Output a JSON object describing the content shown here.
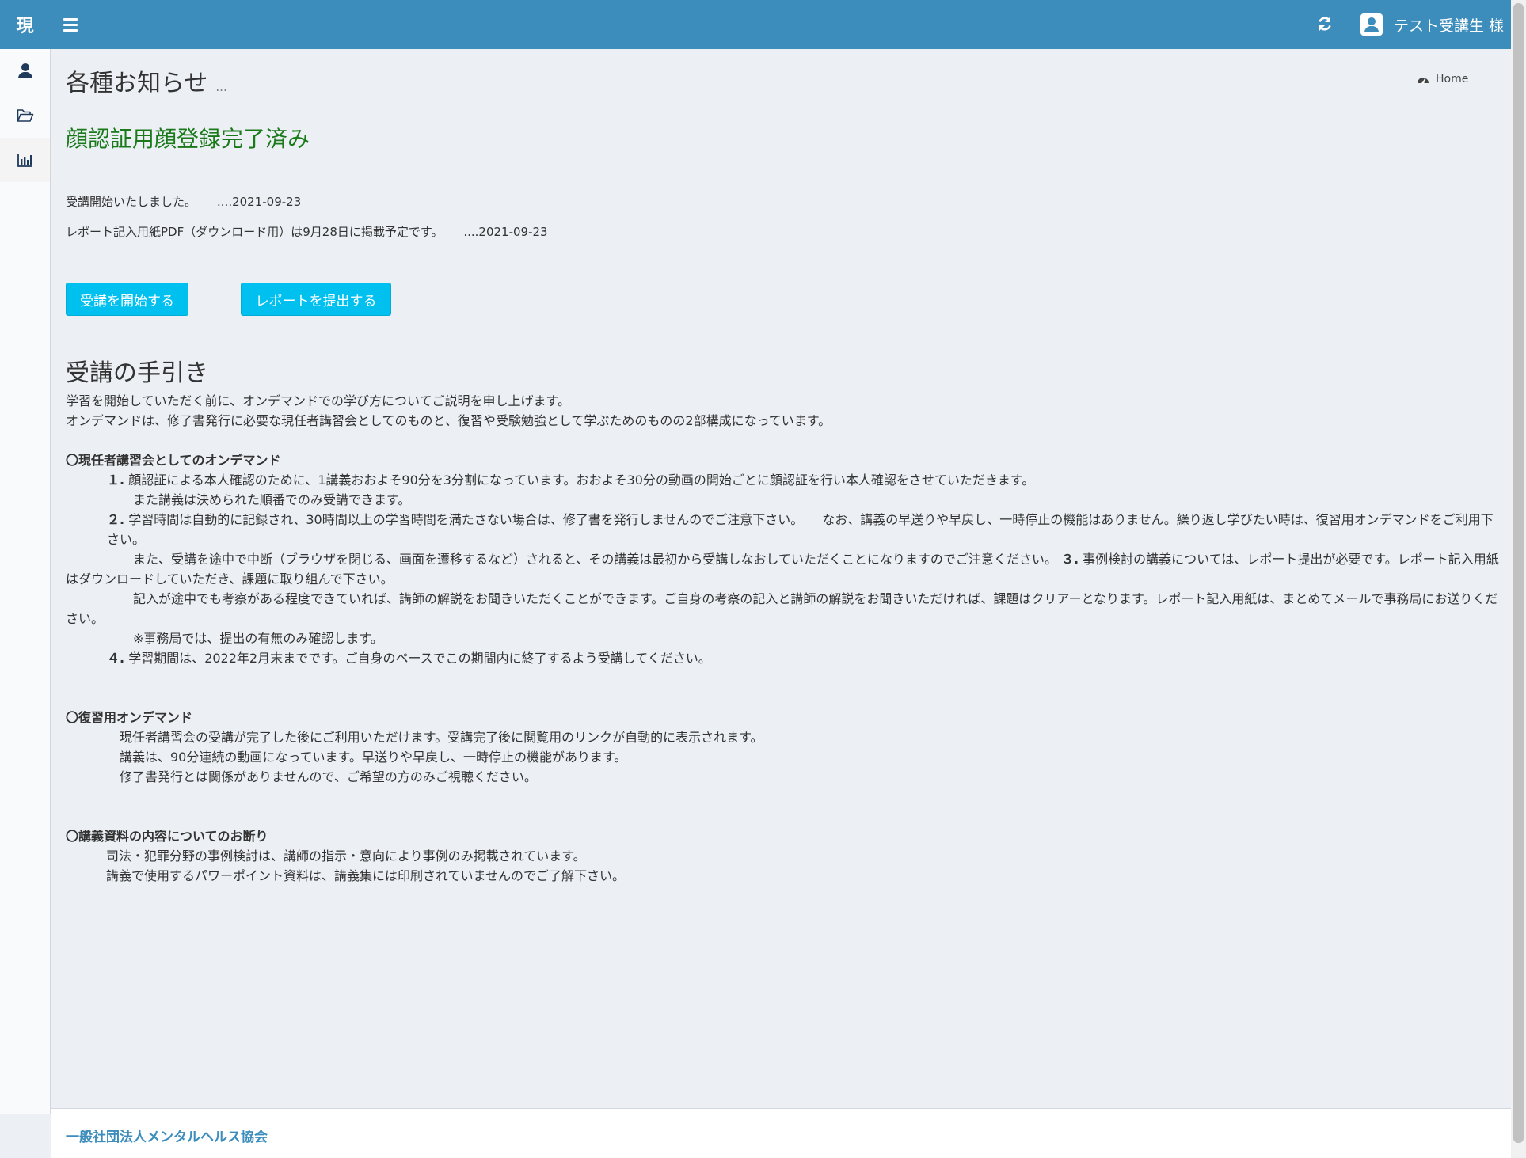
{
  "header": {
    "logo": "現",
    "user_name": "テスト受講生 様"
  },
  "sidebar": {
    "items": [
      {
        "icon": "person-icon"
      },
      {
        "icon": "folder-open-icon"
      },
      {
        "icon": "bar-chart-icon"
      }
    ]
  },
  "page": {
    "title": "各種お知らせ",
    "title_suffix": "...",
    "breadcrumb_home": "Home",
    "face_status": "顔認証用顔登録完了済み"
  },
  "notices": [
    {
      "text": "受講開始いたしました。",
      "date": "....2021-09-23"
    },
    {
      "text": "レポート記入用紙PDF（ダウンロード用）は9月28日に掲載予定です。",
      "date": "....2021-09-23"
    }
  ],
  "buttons": {
    "start": "受講を開始する",
    "report": "レポートを提出する"
  },
  "guide": {
    "title": "受講の手引き",
    "intro1": "学習を開始していただく前に、オンデマンドでの学び方についてご説明を申し上げます。",
    "intro2": "オンデマンドは、修了書発行に必要な現任者講習会としてのものと、復習や受験勉強として学ぶためのものの2部構成になっています。",
    "sec1": "〇現任者講習会としてのオンデマンド",
    "s1_num1": "１.",
    "s1_l1": "顔認証による本人確認のために、1講義おおよそ90分を3分割になっています。おおよそ30分の動画の開始ごとに顔認証を行い本人確認をさせていただきます。",
    "s1_l1b": "また講義は決められた順番でのみ受講できます。",
    "s1_num2": "２.",
    "s1_l2": "学習時間は自動的に記録され、30時間以上の学習時間を満たさない場合は、修了書を発行しませんのでご注意下さい。　　なお、講義の早送りや早戻し、一時停止の機能はありません。繰り返し学びたい時は、復習用オンデマンドをご利用下さい。",
    "s1_l2b": "また、受講を途中で中断（ブラウザを閉じる、画面を遷移するなど）されると、その講義は最初から受講しなおしていただくことになりますのでご注意ください。",
    "s1_num3": "３.",
    "s1_l3": "事例検討の講義については、レポート提出が必要です。レポート記入用紙はダウンロードしていただき、課題に取り組んで下さい。",
    "s1_l3b": "記入が途中でも考察がある程度できていれば、講師の解説をお聞きいただくことができます。ご自身の考察の記入と講師の解説をお聞きいただければ、課題はクリアーとなります。レポート記入用紙は、まとめてメールで事務局にお送りください。",
    "s1_l3c": "※事務局では、提出の有無のみ確認します。",
    "s1_num4": "４.",
    "s1_l4": "学習期間は、2022年2月末までです。ご自身のペースでこの期間内に終了するよう受講してください。",
    "sec2": "〇復習用オンデマンド",
    "s2_l1": "現任者講習会の受講が完了した後にご利用いただけます。受講完了後に閲覧用のリンクが自動的に表示されます。",
    "s2_l2": "講義は、90分連続の動画になっています。早送りや早戻し、一時停止の機能があります。",
    "s2_l3": "修了書発行とは関係がありませんので、ご希望の方のみご視聴ください。",
    "sec3": "〇講義資料の内容についてのお断り",
    "s3_l1": "司法・犯罪分野の事例検討は、講師の指示・意向により事例のみ掲載されています。",
    "s3_l2": "講義で使用するパワーポイント資料は、講義集には印刷されていませんのでご了解下さい。"
  },
  "footer": {
    "org": "一般社団法人メンタルヘルス協会"
  },
  "colors": {
    "header": "#3c8dbc",
    "button": "#00c0ef",
    "status_green": "#1a7a1a",
    "background": "#ecf0f5"
  }
}
